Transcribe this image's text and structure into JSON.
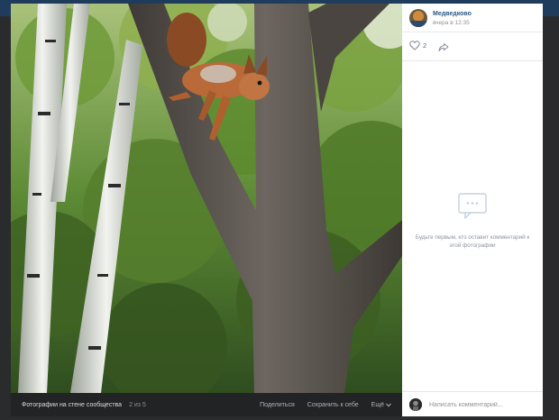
{
  "post": {
    "author_name": "Медведково",
    "date": "вчера в 12:35",
    "like_count": "2",
    "empty_comments_text": "Будьте первым, кто оставит комментарий к этой фотографии"
  },
  "bottom_bar": {
    "album_label": "Фотографии на стене сообщества",
    "counter": "2 из 5",
    "share_label": "Поделиться",
    "save_label": "Сохранить к себе",
    "more_label": "Ещё"
  },
  "comment": {
    "placeholder": "Написать комментарий..."
  },
  "colors": {
    "link": "#2a5885",
    "topbar": "#1f3c5c",
    "viewer_bg": "#2a2b2c"
  },
  "icons": [
    "heart-icon",
    "share-arrow-icon",
    "comments-empty-icon",
    "chevron-down-icon"
  ]
}
